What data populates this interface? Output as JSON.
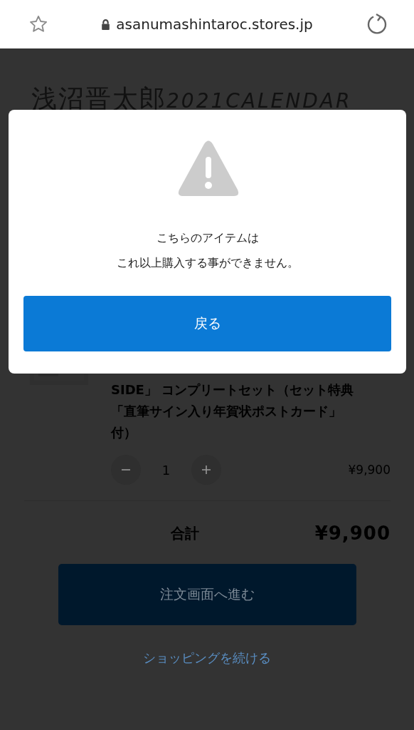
{
  "browser": {
    "url": "asanumashintaroc.stores.jp"
  },
  "page": {
    "title": {
      "name": "浅沼晋太郎",
      "year": "2021CALENDAR"
    },
    "cart_item": {
      "name": "SIDE」 コンプリートセット（セット特典「直筆サイン入り年賀状ポストカード」付）",
      "quantity": "1",
      "price": "¥9,900"
    },
    "total": {
      "label": "合計",
      "amount": "¥9,900"
    },
    "checkout_button": "注文画面へ進む",
    "continue_link": "ショッピングを続ける"
  },
  "dialog": {
    "lines": [
      "こちらのアイテムは",
      "これ以上購入する事ができません。"
    ],
    "button": "戻る"
  }
}
